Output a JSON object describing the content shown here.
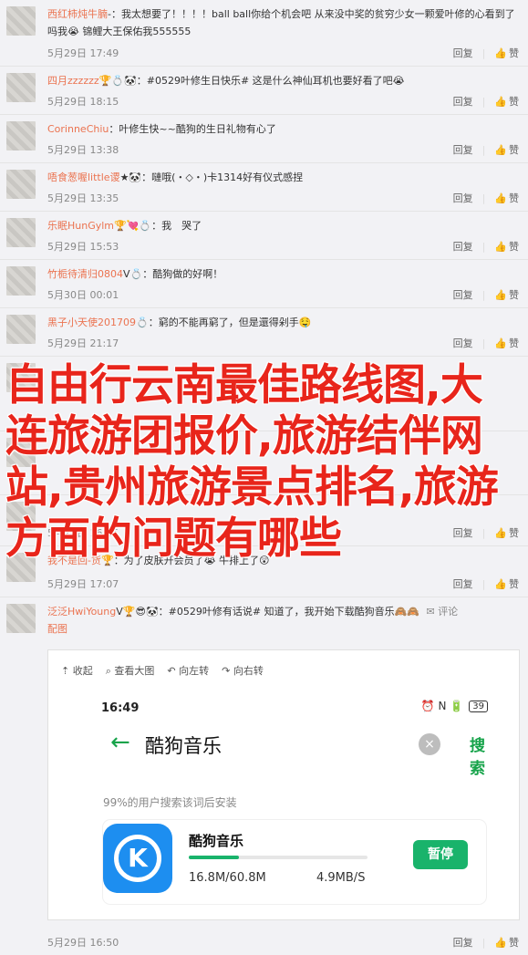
{
  "comments": [
    {
      "user": "西红柿炖牛腩",
      "medals": "-",
      "text": "：我太想要了！！！！ball  ball你给个机会吧 从来没中奖的贫穷少女一颗爱叶修的心看到了吗我😭 锦鲤大王保佑我555555",
      "time": "5月29日 17:49"
    },
    {
      "user": "四月zzzzzz",
      "medals": "🏆💍🐼",
      "text": "：#0529叶修生日快乐# 这是什么神仙耳机也要好看了吧😭",
      "time": "5月29日 18:15"
    },
    {
      "user": "CorinneChiu",
      "medals": "",
      "text": "：叶修生快~~酷狗的生日礼物有心了",
      "time": "5月29日 13:38"
    },
    {
      "user": "唔食葱喔little谡",
      "medals": "★🐼",
      "text": "：嗹哦(・◇・)卡1314好有仪式感捏",
      "time": "5月29日 13:35"
    },
    {
      "user": "乐眠HunGylm",
      "medals": "🏆💘💍",
      "text": "：我　哭了",
      "time": "5月29日 15:53"
    },
    {
      "user": "竹栀待清归0804",
      "medals": "V💍",
      "text": "：酷狗做的好啊！",
      "time": "5月30日 00:01"
    },
    {
      "user": "黑子小天使201709",
      "medals": "💍",
      "text": "：窮的不能再窮了，但是還得剁手🤤",
      "time": "5月29日 21:17"
    },
    {
      "user": "",
      "medals": "",
      "text": "",
      "time": ""
    },
    {
      "user": "",
      "medals": "",
      "text": "",
      "time": ""
    },
    {
      "user": "",
      "medals": "",
      "text": "",
      "time": "5月29日 16:05"
    },
    {
      "user": "我不是回-货",
      "medals": "🏆",
      "text": "：为了皮肤开会员了😭 牛排上了😲",
      "time": "5月29日 17:07"
    },
    {
      "user": "泛泛HwiYoung",
      "medals": "V🏆😎🐼",
      "text": "：#0529叶修有话说# 知道了，我开始下载酷狗音乐🙈🙈",
      "time": "5月29日 16:50"
    }
  ],
  "actions": {
    "reply": "回复",
    "like": "赞"
  },
  "comment_action": "评论",
  "image_link": "配图",
  "overlay_title": "自由行云南最佳路线图,大连旅游团报价,旅游结伴网站,贵州旅游景点排名,旅游方面的问题有哪些",
  "image_toolbar": {
    "collapse": "收起",
    "view_large": "查看大图",
    "rotate_left": "向左转",
    "rotate_right": "向右转"
  },
  "phone": {
    "time": "16:49",
    "status_icons": "⏰ N 🔋",
    "battery": "39",
    "back_arrow": "←",
    "query": "酷狗音乐",
    "clear": "×",
    "search_button": "搜索",
    "hint": "99%的用户搜索该词后安装",
    "app_name": "酷狗音乐",
    "app_letter": "K",
    "size": "16.8M/60.8M",
    "speed": "4.9MB/S",
    "pause_button": "暂停",
    "progress": 0.28
  },
  "colors": {
    "accent": "#eb7350",
    "brand_green": "#19b36b",
    "overlay_red": "#e8251b"
  }
}
